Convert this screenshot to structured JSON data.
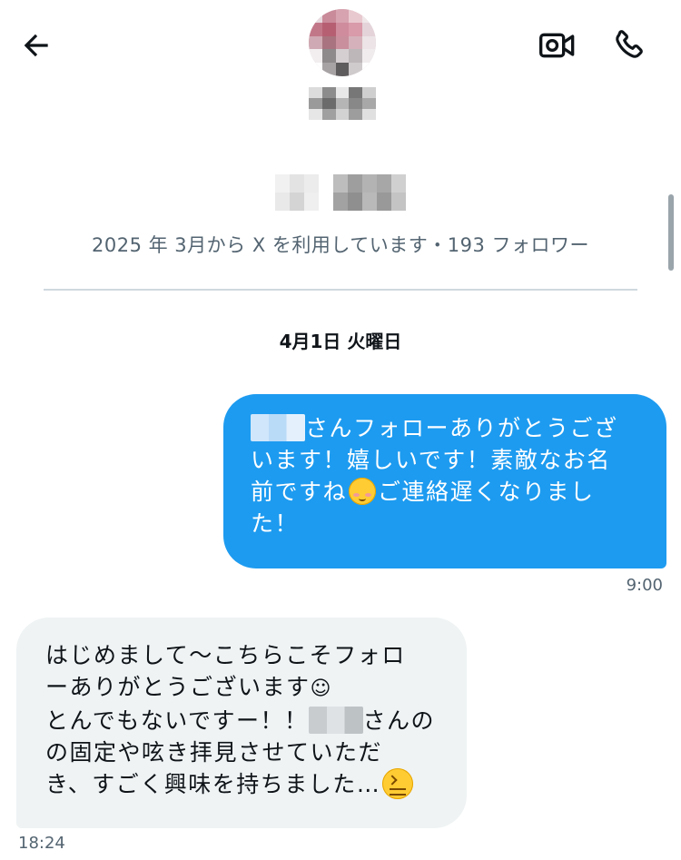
{
  "header": {
    "back_icon": "arrow-left-icon",
    "video_icon": "video-camera-icon",
    "call_icon": "phone-icon"
  },
  "profile": {
    "meta": "2025 年 3月から X を利用しています・193 フォロワー"
  },
  "conversation": {
    "date_label": "4月1日 火曜日",
    "messages": [
      {
        "direction": "sent",
        "lines": [
          "さんフォローありがとうござ",
          "います！嬉しいです！素敵なお名",
          "前ですね",
          "ご連絡遅くなりまし",
          "た！"
        ],
        "emoji": "smiling-face-icon",
        "time": "9:00"
      },
      {
        "direction": "received",
        "lines": [
          "はじめまして～こちらこそフォロ",
          "ーありがとうございます",
          "☺",
          "とんでもないですー！！",
          "さんの",
          "の固定や呟き拝見させていただ",
          "き、すごく興味を持ちました…"
        ],
        "emoji": "confounded-face-icon",
        "time": "18:24"
      }
    ]
  },
  "colors": {
    "sent_bubble": "#1d9bf0",
    "received_bubble": "#eff3f4",
    "secondary_text": "#536471",
    "divider": "#cfd9de"
  }
}
